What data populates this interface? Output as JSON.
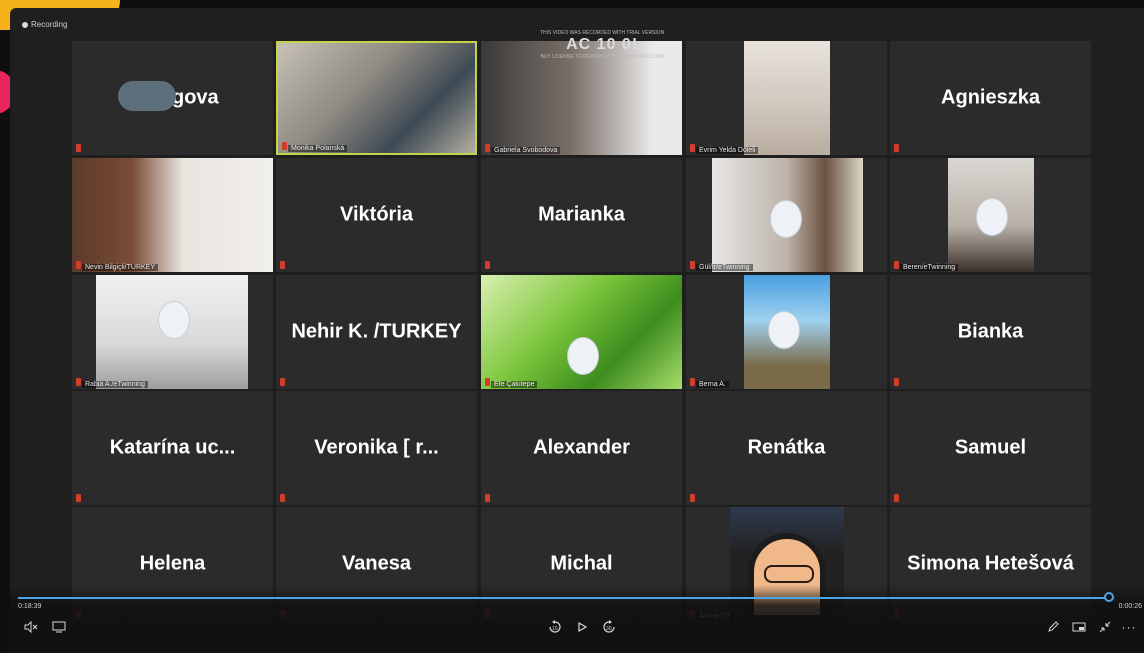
{
  "app": {
    "recording_label": "Recording"
  },
  "watermark": {
    "line1": "THIS VIDEO WAS RECORDED WITH TRIAL VERSION",
    "logo": "AC 10 0!",
    "line2": "BUY LICENSE TO REMOVE IT: WWW.ACVIDEO.COM"
  },
  "tiles": [
    {
      "name": "gova",
      "label": "",
      "video": false
    },
    {
      "name": "",
      "label": "Monika Polanská",
      "video": true
    },
    {
      "name": "",
      "label": "Gabriela Svobodova",
      "video": true
    },
    {
      "name": "",
      "label": "Evrim Yelda Döleli",
      "video": true
    },
    {
      "name": "Agnieszka",
      "label": "",
      "video": false
    },
    {
      "name": "",
      "label": "Nevin Bilgiçli/TURKEY",
      "video": true
    },
    {
      "name": "Viktória",
      "label": "",
      "video": false
    },
    {
      "name": "Marianka",
      "label": "",
      "video": false
    },
    {
      "name": "",
      "label": "Gül/tr/eTwinning",
      "video": true
    },
    {
      "name": "",
      "label": "Beren/eTwinning",
      "video": true
    },
    {
      "name": "",
      "label": "Rabia A./eTwinning",
      "video": true
    },
    {
      "name": "Nehir K. /TURKEY",
      "label": "",
      "video": false
    },
    {
      "name": "",
      "label": "Efe Çakıtepe",
      "video": true
    },
    {
      "name": "",
      "label": "Berna A.",
      "video": true
    },
    {
      "name": "Bianka",
      "label": "",
      "video": false
    },
    {
      "name": "Katarína      uc...",
      "label": "",
      "video": false
    },
    {
      "name": "Veronika [      r...",
      "label": "",
      "video": false
    },
    {
      "name": "Alexander",
      "label": "",
      "video": false
    },
    {
      "name": "Renátka",
      "label": "",
      "video": false
    },
    {
      "name": "Samuel",
      "label": "",
      "video": false
    },
    {
      "name": "Helena",
      "label": "",
      "video": false
    },
    {
      "name": "Vanesa",
      "label": "",
      "video": false
    },
    {
      "name": "Michal",
      "label": "",
      "video": false
    },
    {
      "name": "",
      "label": "Amine TR",
      "video": true
    },
    {
      "name": "Simona Hetešová",
      "label": "",
      "video": false
    }
  ],
  "player": {
    "elapsed": "0:18:39",
    "remaining": "0:00:26",
    "progress_fraction": 0.995,
    "accent": "#4aa3e6"
  },
  "colors": {
    "active_speaker": "#c4d44a",
    "mic_muted": "#d33b2b"
  }
}
